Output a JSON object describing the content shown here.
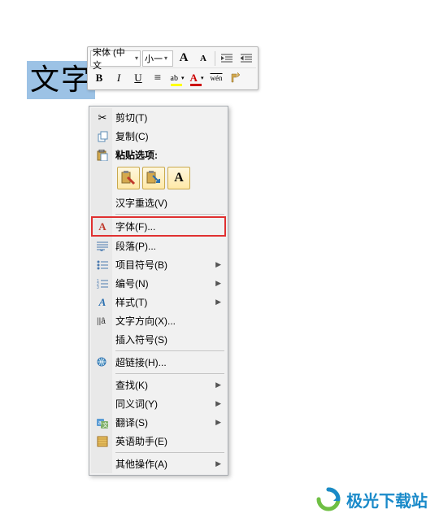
{
  "selected_text": "文字",
  "mini_toolbar": {
    "font_name": "宋体 (中文",
    "font_size": "小一",
    "grow": "A",
    "shrink": "A",
    "bold": "B",
    "italic": "I",
    "underline": "U",
    "center": "≡",
    "highlight": "ab",
    "font_color": "A",
    "phonetic": "wén",
    "format_painter": "✎"
  },
  "menu": {
    "cut": "剪切(T)",
    "copy": "复制(C)",
    "paste_options": "粘贴选项:",
    "reconvert": "汉字重选(V)",
    "font": "字体(F)...",
    "paragraph": "段落(P)...",
    "bullets": "项目符号(B)",
    "numbering": "编号(N)",
    "styles": "样式(T)",
    "text_direction": "文字方向(X)...",
    "insert_symbol": "插入符号(S)",
    "hyperlink": "超链接(H)...",
    "find": "查找(K)",
    "synonyms": "同义词(Y)",
    "translate": "翻译(S)",
    "english_assistant": "英语助手(E)",
    "other": "其他操作(A)"
  },
  "watermark": "极光下载站"
}
